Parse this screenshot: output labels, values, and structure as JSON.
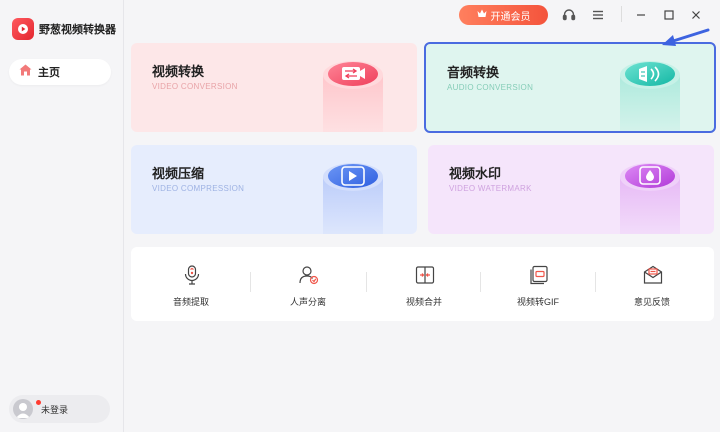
{
  "app": {
    "title": "野葱视频转换器"
  },
  "sidebar": {
    "home_label": "主页",
    "login_label": "未登录"
  },
  "topbar": {
    "vip_label": "开通会员"
  },
  "cards": [
    {
      "title": "视频转换",
      "subtitle": "VIDEO CONVERSION"
    },
    {
      "title": "音频转换",
      "subtitle": "AUDIO CONVERSION"
    },
    {
      "title": "视频压缩",
      "subtitle": "VIDEO COMPRESSION"
    },
    {
      "title": "视频水印",
      "subtitle": "VIDEO WATERMARK"
    }
  ],
  "tools": [
    {
      "label": "音频提取"
    },
    {
      "label": "人声分离"
    },
    {
      "label": "视频合并"
    },
    {
      "label": "视频转GIF"
    },
    {
      "label": "意见反馈"
    }
  ],
  "colors": {
    "accent": "#f4543c",
    "selection": "#4a6be0",
    "video_conversion": "#f04e66",
    "audio_conversion": "#22c4b0",
    "video_compression": "#3b6fe3",
    "video_watermark": "#c04fe0"
  }
}
